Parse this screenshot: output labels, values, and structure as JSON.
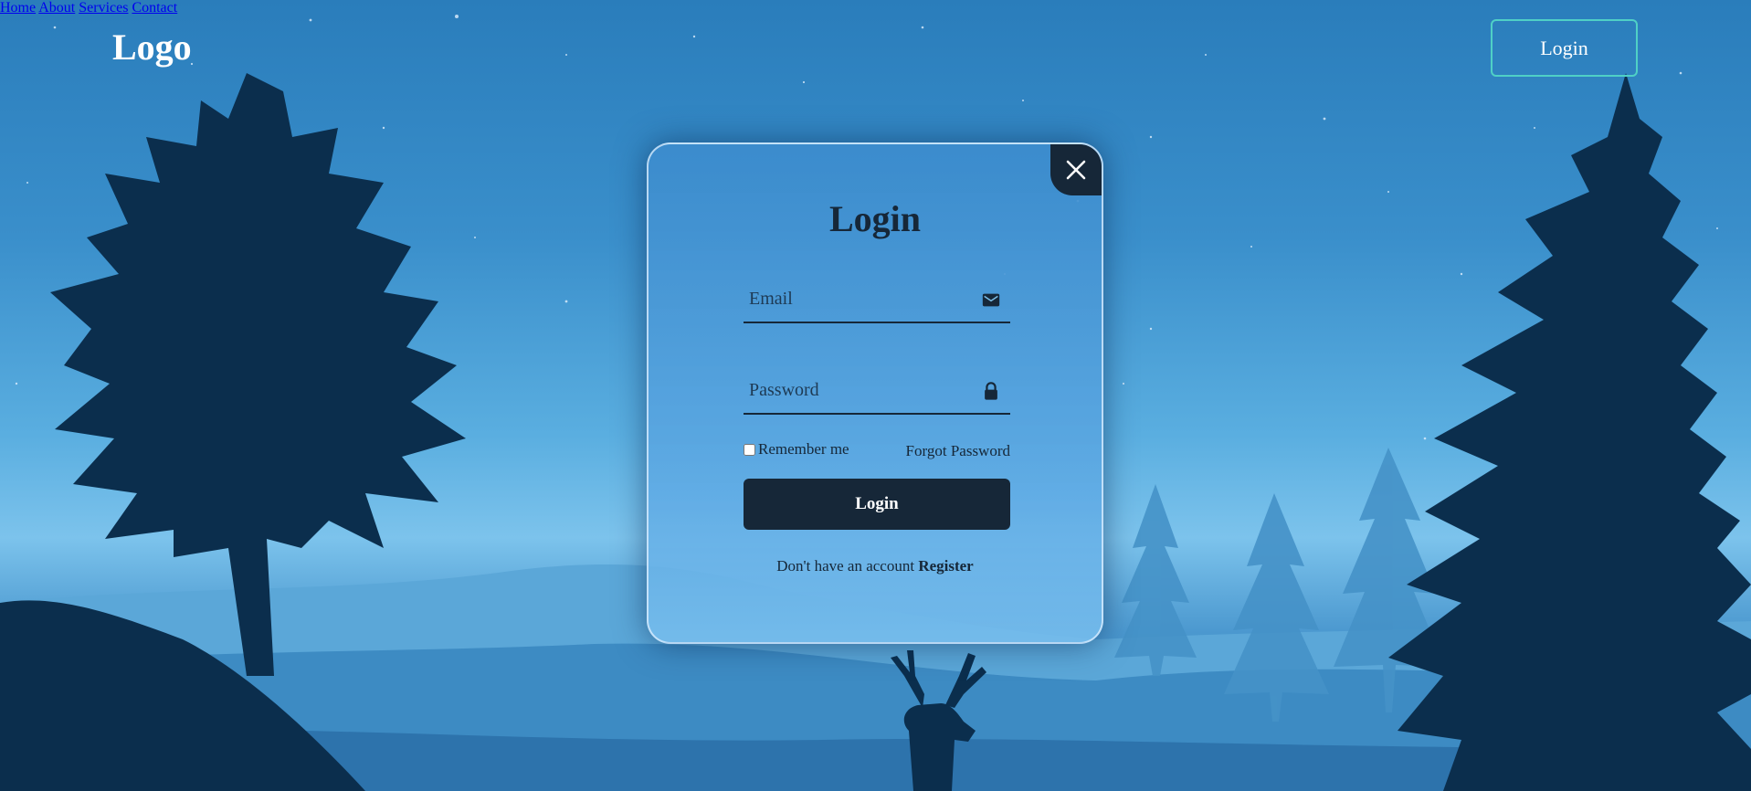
{
  "nav": {
    "logo": "Logo",
    "links": [
      "Home",
      "About",
      "Services",
      "Contact"
    ],
    "login_button": "Login"
  },
  "modal": {
    "title": "Login",
    "email_placeholder": "Email",
    "password_placeholder": "Password",
    "remember_label": "Remember me",
    "forgot_label": "Forgot Password",
    "submit_label": "Login",
    "register_prompt": "Don't have an account",
    "register_link": "Register"
  },
  "icons": {
    "close": "close-icon",
    "email": "mail-icon",
    "password": "lock-icon"
  },
  "colors": {
    "accent_border": "#4fd0c6",
    "dark": "#162738",
    "sky_top": "#2a7dbb",
    "sky_horizon": "#7cc3ec"
  }
}
